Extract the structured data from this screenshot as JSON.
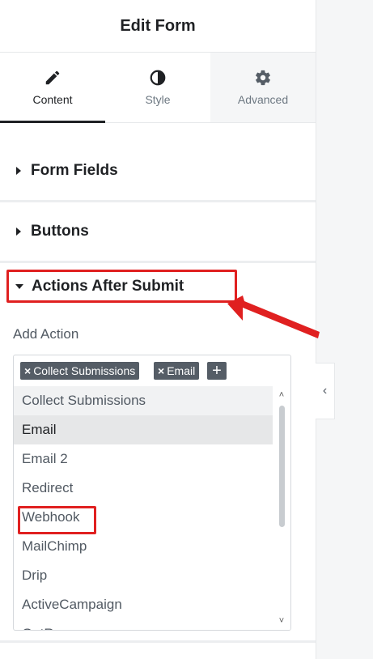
{
  "panel": {
    "title": "Edit Form",
    "tabs": [
      {
        "label": "Content",
        "icon": "pencil-icon",
        "active": true
      },
      {
        "label": "Style",
        "icon": "half-circle-icon",
        "active": false
      },
      {
        "label": "Advanced",
        "icon": "gear-icon",
        "active": false
      }
    ],
    "sections": {
      "form_fields": "Form Fields",
      "buttons": "Buttons",
      "actions_after_submit": "Actions After Submit"
    },
    "add_action_label": "Add Action",
    "chips": [
      {
        "label": "Collect Submissions"
      },
      {
        "label": "Email"
      }
    ],
    "chip_remove_glyph": "×",
    "add_chip_glyph": "+",
    "options": [
      {
        "label": "Collect Submissions",
        "state": "hover"
      },
      {
        "label": "Email",
        "state": "selected"
      },
      {
        "label": "Email 2",
        "state": ""
      },
      {
        "label": "Redirect",
        "state": ""
      },
      {
        "label": "Webhook",
        "state": "highlighted"
      },
      {
        "label": "MailChimp",
        "state": ""
      },
      {
        "label": "Drip",
        "state": ""
      },
      {
        "label": "ActiveCampaign",
        "state": ""
      },
      {
        "label": "GetResponse",
        "state": "partially-visible"
      }
    ],
    "collapse_glyph": "‹"
  },
  "colors": {
    "annotation_red": "#e02020",
    "chip_bg": "#555d66",
    "text_dark": "#1f2124",
    "text_muted": "#515962"
  }
}
